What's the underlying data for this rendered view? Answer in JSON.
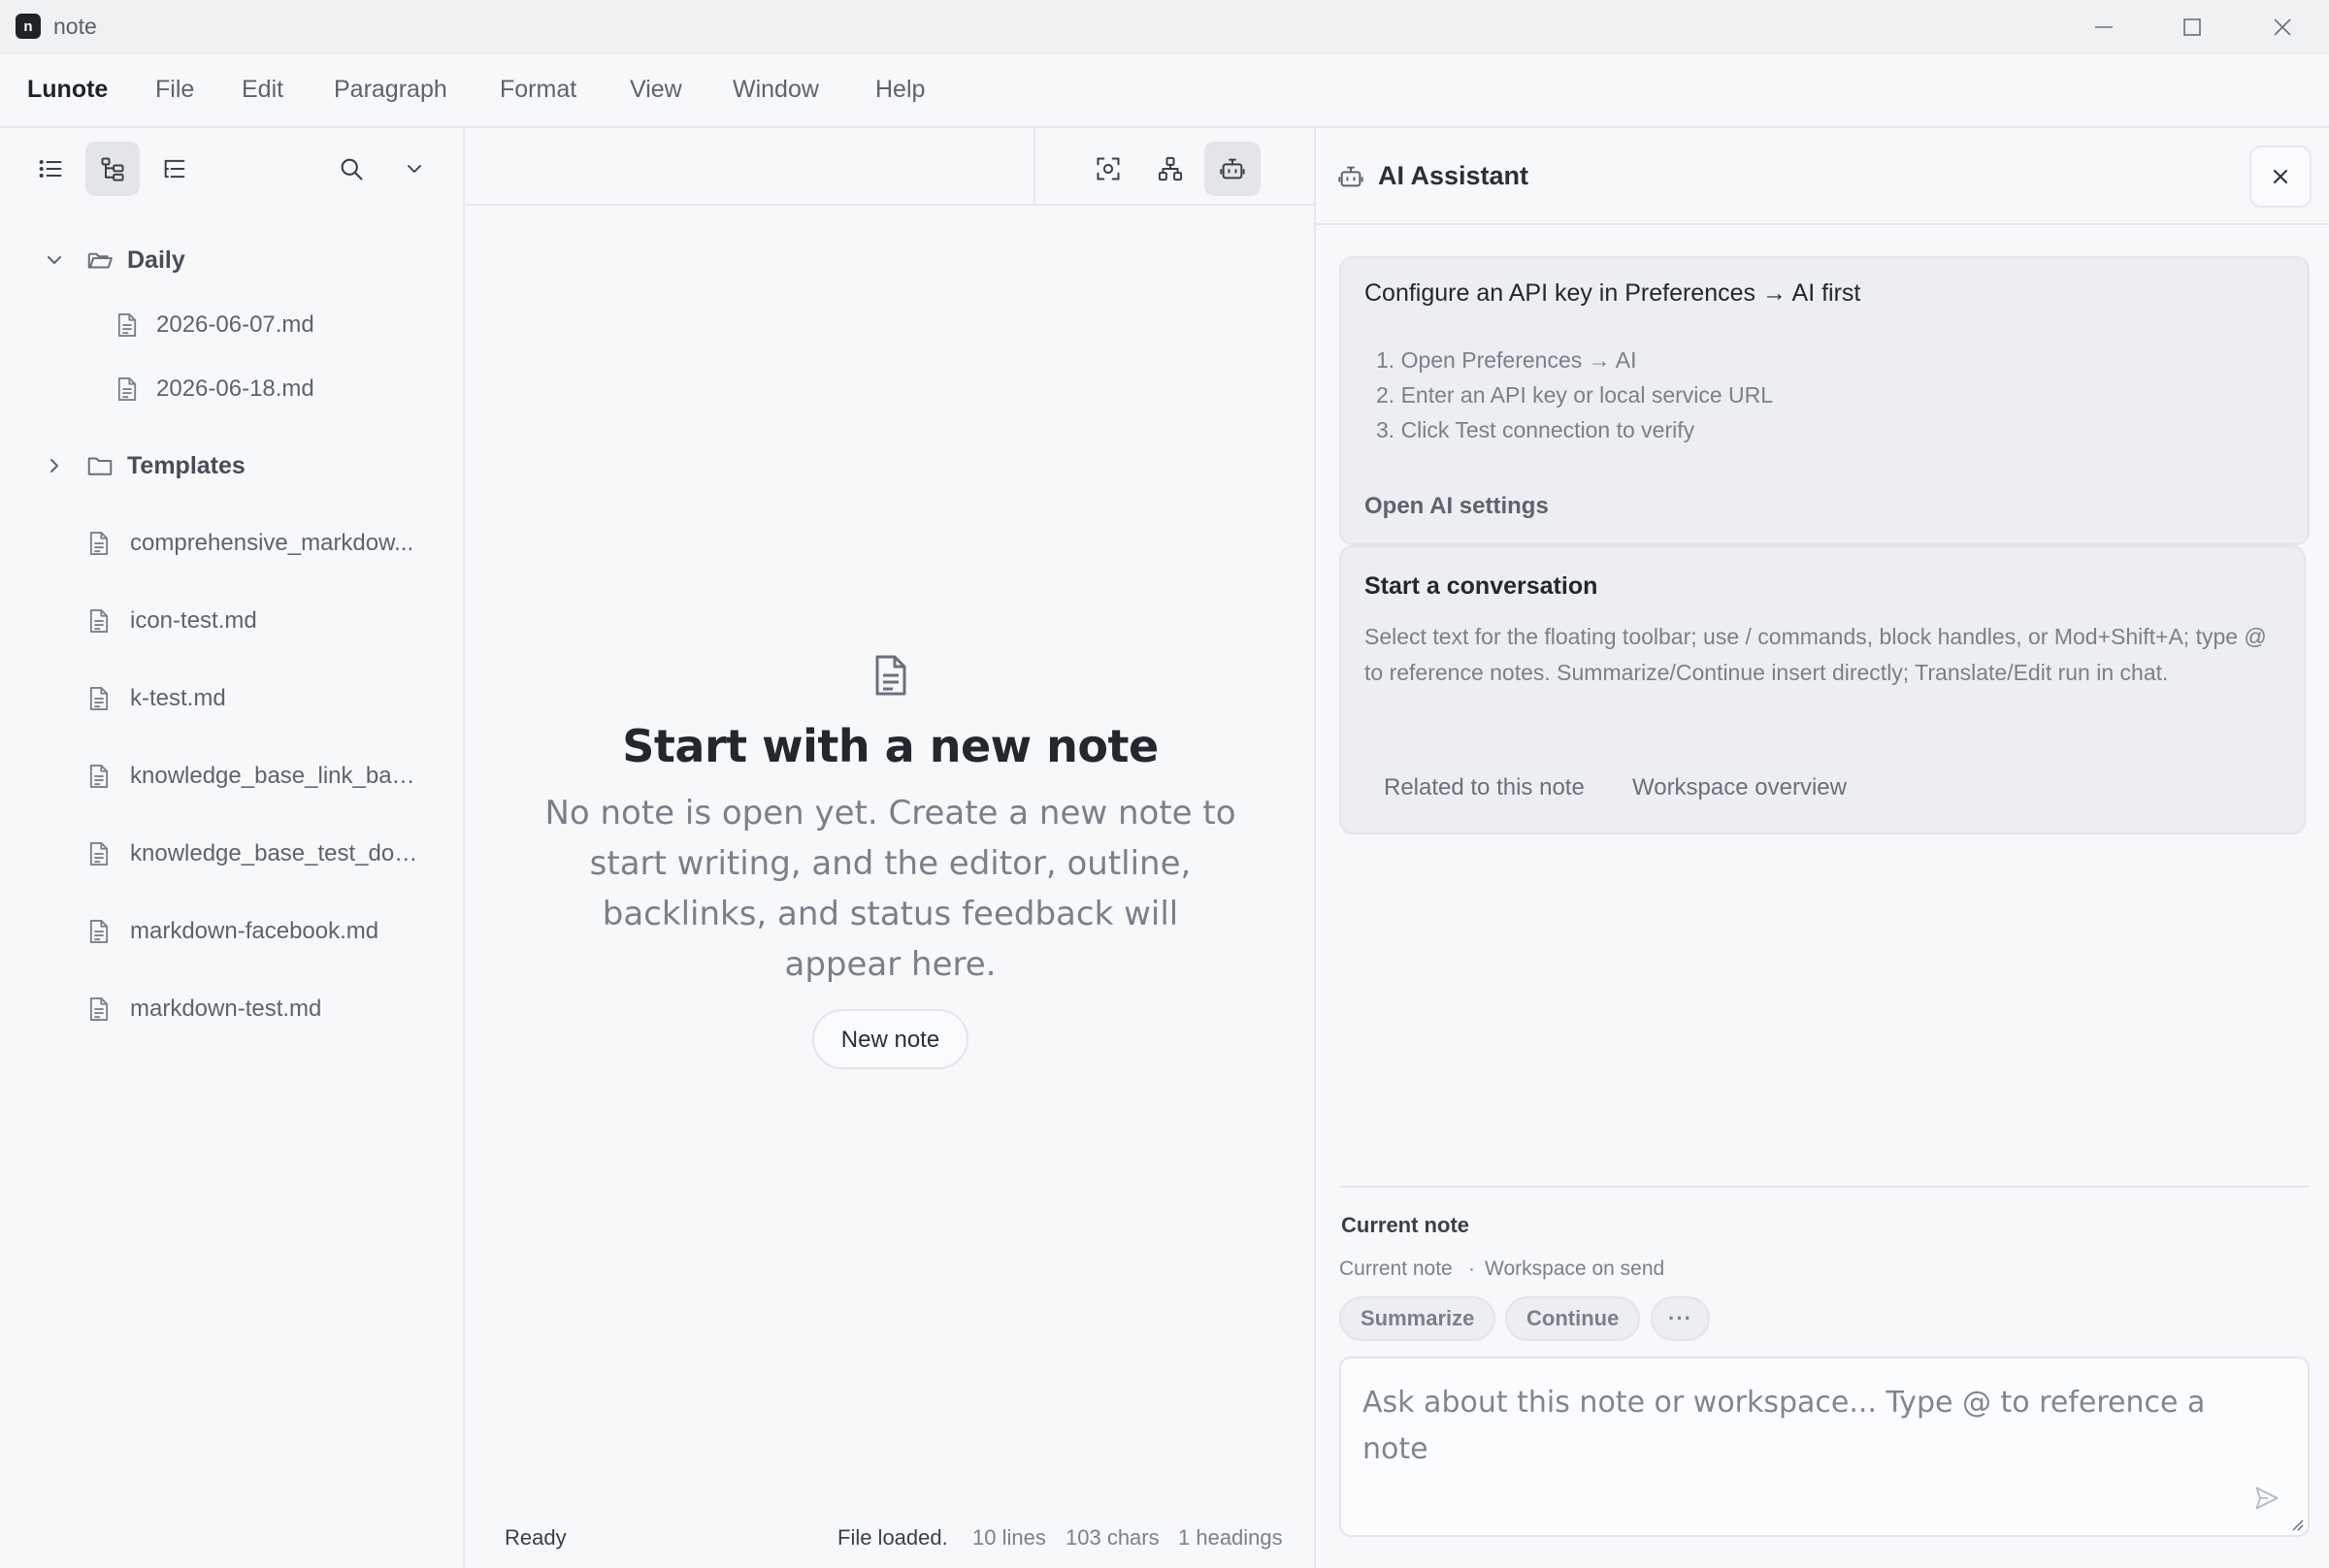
{
  "window": {
    "title": "note",
    "logo_letter": "n"
  },
  "menu": {
    "brand": "Lunote",
    "items": [
      "File",
      "Edit",
      "Paragraph",
      "Format",
      "View",
      "Window",
      "Help"
    ]
  },
  "sidebar": {
    "tree": {
      "daily_folder": "Daily",
      "daily_files": [
        "2026-06-07.md",
        "2026-06-18.md"
      ],
      "templates_folder": "Templates",
      "files": [
        "comprehensive_markdow...",
        "icon-test.md",
        "k-test.md",
        "knowledge_base_link_bac...",
        "knowledge_base_test_doc...",
        "markdown-facebook.md",
        "markdown-test.md"
      ]
    }
  },
  "editor": {
    "empty": {
      "title": "Start with a new note",
      "description": "No note is open yet. Create a new note to start writing, and the editor, outline, backlinks, and status feedback will appear here.",
      "button": "New note"
    },
    "status": {
      "left": "Ready",
      "message": "File loaded.",
      "lines": "10 lines",
      "chars": "103 chars",
      "headings": "1 headings"
    }
  },
  "ai": {
    "title": "AI Assistant",
    "setup_card": {
      "title": "Configure an API key in Preferences → AI first",
      "steps": [
        "1. Open Preferences → AI",
        "2. Enter an API key or local service URL",
        "3. Click Test connection to verify"
      ],
      "link": "Open AI settings"
    },
    "conversation_card": {
      "title": "Start a conversation",
      "description": "Select text for the floating toolbar; use / commands, block handles, or Mod+Shift+A; type @ to reference notes. Summarize/Continue insert directly; Translate/Edit run in chat.",
      "suggestions": [
        "Related to this note",
        "Workspace overview"
      ]
    },
    "context": {
      "label": "Current note",
      "scope": "Current note",
      "separator": "·",
      "mode": "Workspace on send"
    },
    "actions": [
      "Summarize",
      "Continue",
      "···"
    ],
    "input": {
      "placeholder": "Ask about this note or workspace... Type @ to reference a note",
      "value": ""
    }
  },
  "colors": {
    "background": "#f7f8fa",
    "titlebar": "#f0f1f3",
    "border": "#e6e8eb",
    "card": "#eceef1",
    "active_button": "#e3e5e9",
    "text_primary": "#23272e",
    "text_muted": "#7a808a"
  }
}
